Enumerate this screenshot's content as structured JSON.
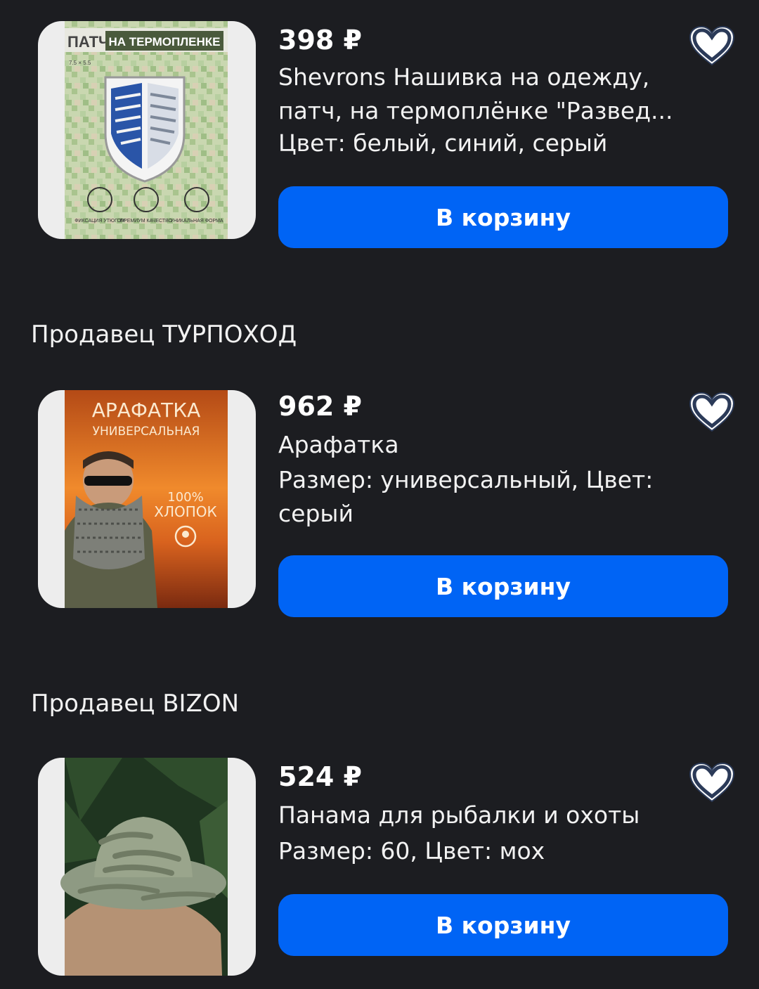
{
  "products": [
    {
      "price": "398 ₽",
      "title": "Shevrons Нашивка на одежду, патч, на термоплёнке \"Развед...",
      "variant": "Цвет: белый, синий, серый",
      "cart_label": "В корзину",
      "image": {
        "header_left": "ПАТЧ",
        "header_right": "НА ТЕРМОПЛЕНКЕ",
        "size_note": "7.5 × 5.5",
        "badges": [
          "ФИКСАЦИЯ УТЮГОМ",
          "ПРЕМИУМ КАЧЕСТВО",
          "УНИКАЛЬНАЯ ФОРМА"
        ]
      }
    },
    {
      "seller": "Продавец ТУРПОХОД",
      "price": "962 ₽",
      "title": "Арафатка",
      "variant": "Размер: универсальный, Цвет: серый",
      "cart_label": "В корзину",
      "image": {
        "headline": "АРАФАТКА",
        "subline": "УНИВЕРСАЛЬНАЯ",
        "material_pct": "100%",
        "material": "ХЛОПОК"
      }
    },
    {
      "seller": "Продавец BIZON",
      "price": "524 ₽",
      "title": "Панама для рыбалки и охоты",
      "variant": "Размер: 60, Цвет: мох",
      "cart_label": "В корзину"
    }
  ],
  "colors": {
    "background": "#1c1d21",
    "button": "#0064f5",
    "text": "#ffffff"
  }
}
